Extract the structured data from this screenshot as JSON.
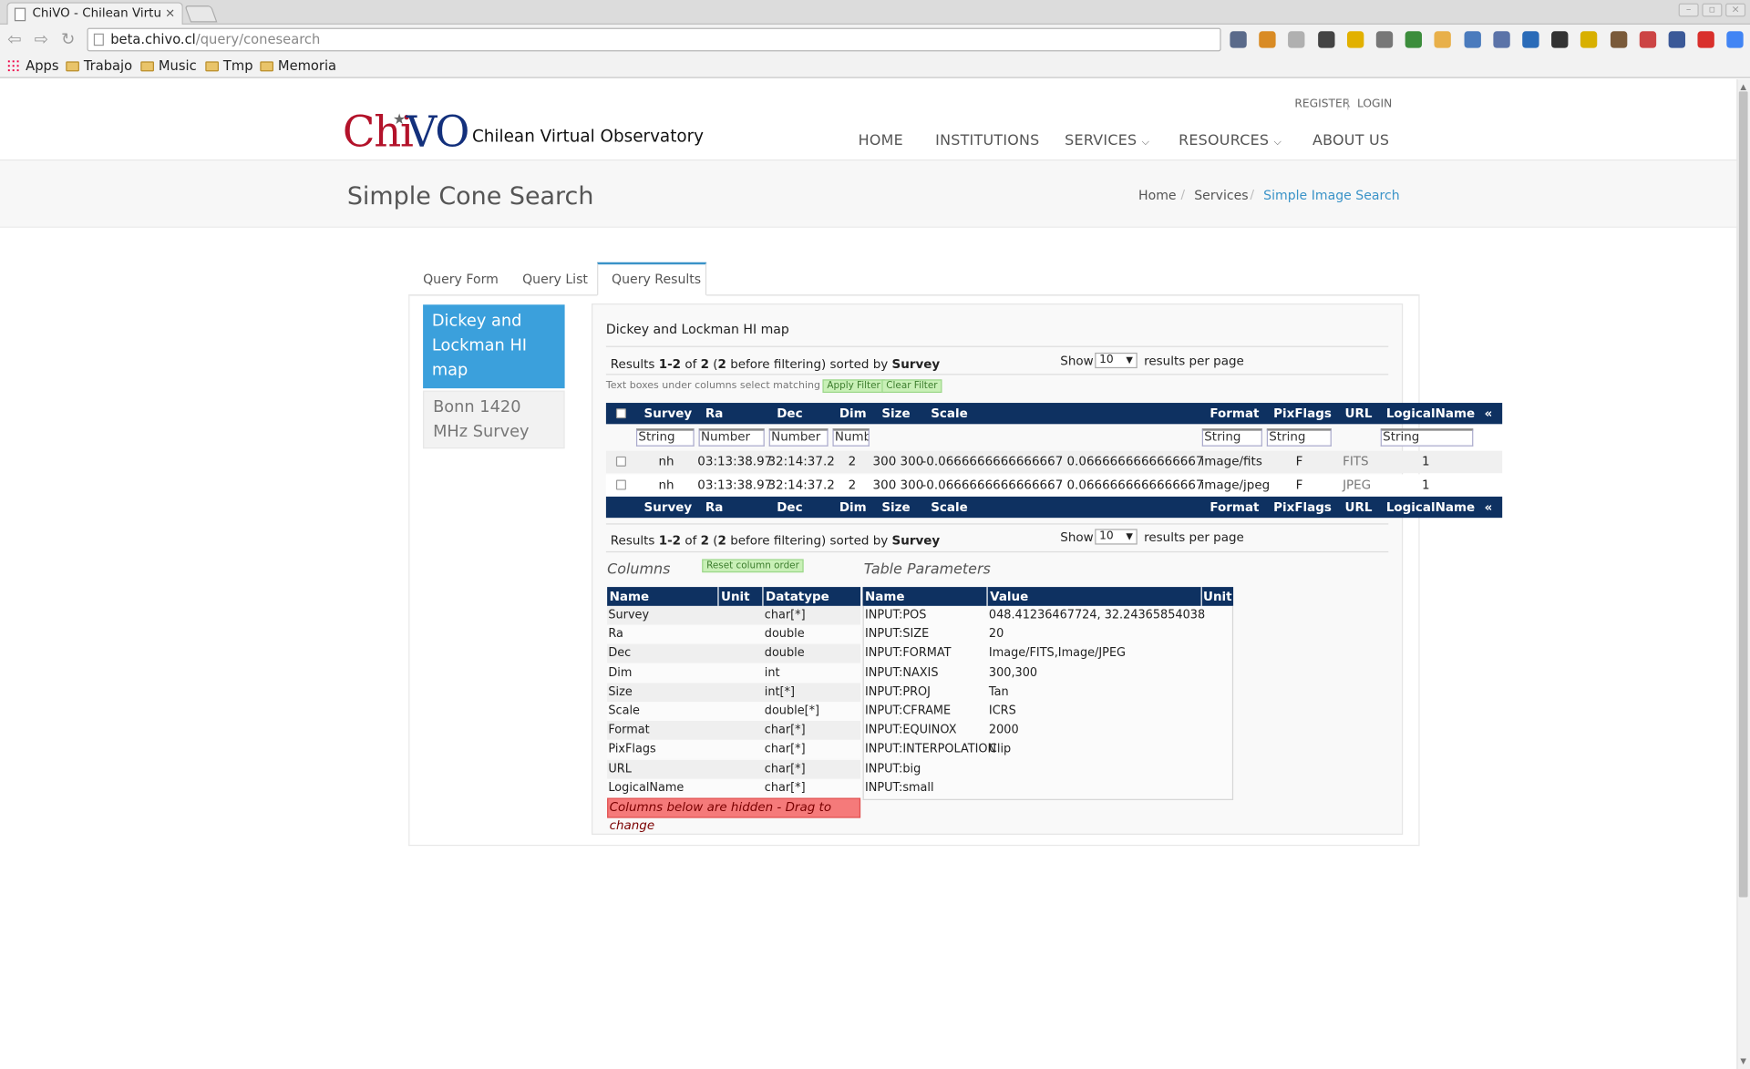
{
  "browser": {
    "tab_title": "ChiVO - Chilean Virtu",
    "tab_close": "×",
    "url_host": "beta.chivo.cl",
    "url_path": "/query/conesearch",
    "window_buttons": [
      "–",
      "▫",
      "×"
    ],
    "bookmarks": [
      "Apps",
      "Trabajo",
      "Music",
      "Tmp",
      "Memoria"
    ],
    "extension_icons": [
      "pi-icon",
      "basket-icon",
      "bell-icon",
      "wordpress-icon",
      "imdb-icon",
      "scanner-icon",
      "green-bag-icon",
      "cube-icon",
      "docs-icon",
      "list-icon",
      "euro-icon",
      "phone-icon",
      "pin-icon",
      "camera-icon",
      "download-icon",
      "facebook-icon",
      "adblock-icon",
      "translate-icon",
      "menu-icon"
    ]
  },
  "site": {
    "logo_chi": "Chi",
    "logo_vo": "VO",
    "logo_sub": "Chilean Virtual Observatory",
    "register": "REGISTER",
    "login": "LOGIN",
    "toplink_sep": "|",
    "nav": {
      "home": "HOME",
      "institutions": "INSTITUTIONS",
      "services": "SERVICES",
      "resources": "RESOURCES",
      "about": "ABOUT US"
    },
    "colors": {
      "brand_red": "#b3122a",
      "brand_blue": "#13307c",
      "accent": "#3a93c8",
      "table_header": "#0e3161"
    }
  },
  "page": {
    "title": "Simple Cone Search",
    "breadcrumb": [
      "Home",
      "Services",
      "Simple Image Search"
    ],
    "crumb_sep": "/",
    "tabs": [
      "Query Form",
      "Query List",
      "Query Results"
    ],
    "active_tab": "Query Results"
  },
  "services": [
    "Dickey and Lockman HI map",
    "Bonn 1420 MHz Survey"
  ],
  "results": {
    "title": "Dickey and Lockman HI map",
    "summary": {
      "prefix": "Results ",
      "range": "1-2",
      "of": " of ",
      "total": "2",
      "paren_open": " (",
      "before": "2",
      "suffix": " before filtering) sorted by ",
      "sort": "Survey"
    },
    "show_label": "Show",
    "per_page": "10",
    "per_page_label": "results per page",
    "filter_hint": "Text boxes under columns select matching rows",
    "apply_filter": "Apply Filter",
    "clear_filter": "Clear Filter",
    "collapse_symbol": "«",
    "headers": [
      "Survey",
      "Ra",
      "Dec",
      "Dim",
      "Size",
      "Scale",
      "Format",
      "PixFlags",
      "URL",
      "LogicalName"
    ],
    "filters": [
      "String",
      "Number",
      "Number",
      "Numb",
      "String",
      "String",
      "String"
    ],
    "rows": [
      {
        "survey": "nh",
        "ra": "03:13:38.97",
        "dec": "32:14:37.2",
        "dim": "2",
        "size": "300 300",
        "scale": "-0.0666666666666667 0.0666666666666667",
        "format": "image/fits",
        "pixflags": "F",
        "url": "FITS",
        "logical": "1"
      },
      {
        "survey": "nh",
        "ra": "03:13:38.97",
        "dec": "32:14:37.2",
        "dim": "2",
        "size": "300 300",
        "scale": "-0.0666666666666667 0.0666666666666667",
        "format": "image/jpeg",
        "pixflags": "F",
        "url": "JPEG",
        "logical": "1"
      }
    ]
  },
  "columns": {
    "heading": "Columns",
    "reset_button": "Reset column order",
    "headers": [
      "Name",
      "Unit",
      "Datatype"
    ],
    "rows": [
      {
        "name": "Survey",
        "unit": "",
        "type": "char[*]"
      },
      {
        "name": "Ra",
        "unit": "",
        "type": "double"
      },
      {
        "name": "Dec",
        "unit": "",
        "type": "double"
      },
      {
        "name": "Dim",
        "unit": "",
        "type": "int"
      },
      {
        "name": "Size",
        "unit": "",
        "type": "int[*]"
      },
      {
        "name": "Scale",
        "unit": "",
        "type": "double[*]"
      },
      {
        "name": "Format",
        "unit": "",
        "type": "char[*]"
      },
      {
        "name": "PixFlags",
        "unit": "",
        "type": "char[*]"
      },
      {
        "name": "URL",
        "unit": "",
        "type": "char[*]"
      },
      {
        "name": "LogicalName",
        "unit": "",
        "type": "char[*]"
      }
    ],
    "hidden_note": "Columns below are hidden - Drag to change"
  },
  "params": {
    "heading": "Table Parameters",
    "headers": [
      "Name",
      "Value",
      "Unit"
    ],
    "rows": [
      {
        "name": "INPUT:POS",
        "value": "048.41236467724, 32.24365854038",
        "unit": ""
      },
      {
        "name": "INPUT:SIZE",
        "value": "20",
        "unit": ""
      },
      {
        "name": "INPUT:FORMAT",
        "value": "Image/FITS,Image/JPEG",
        "unit": ""
      },
      {
        "name": "INPUT:NAXIS",
        "value": "300,300",
        "unit": ""
      },
      {
        "name": "INPUT:PROJ",
        "value": "Tan",
        "unit": ""
      },
      {
        "name": "INPUT:CFRAME",
        "value": "ICRS",
        "unit": ""
      },
      {
        "name": "INPUT:EQUINOX",
        "value": "2000",
        "unit": ""
      },
      {
        "name": "INPUT:INTERPOLATION",
        "value": "Clip",
        "unit": ""
      },
      {
        "name": "INPUT:big",
        "value": "",
        "unit": ""
      },
      {
        "name": "INPUT:small",
        "value": "",
        "unit": ""
      }
    ]
  }
}
